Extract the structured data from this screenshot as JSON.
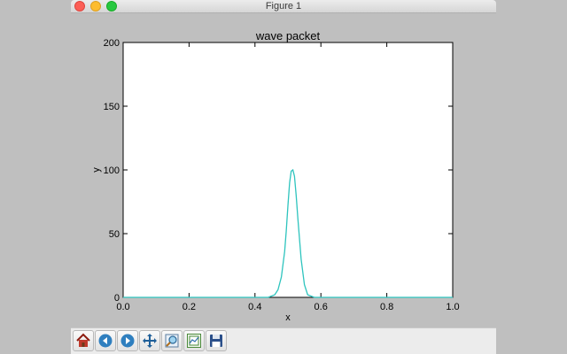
{
  "window": {
    "title": "Figure 1"
  },
  "toolbar": {
    "buttons": [
      {
        "icon": "home-icon",
        "tooltip": "Reset original view"
      },
      {
        "icon": "back-arrow-icon",
        "tooltip": "Back to previous view"
      },
      {
        "icon": "forward-arrow-icon",
        "tooltip": "Forward to next view"
      },
      {
        "icon": "pan-move-icon",
        "tooltip": "Pan axes"
      },
      {
        "icon": "zoom-rectangle-icon",
        "tooltip": "Zoom to rectangle"
      },
      {
        "icon": "configure-subplots-icon",
        "tooltip": "Configure subplots"
      },
      {
        "icon": "save-floppy-icon",
        "tooltip": "Save the figure"
      }
    ]
  },
  "chart_data": {
    "type": "line",
    "title": "wave packet",
    "xlabel": "x",
    "ylabel": "y",
    "xlim": [
      0.0,
      1.0
    ],
    "ylim": [
      0,
      200
    ],
    "xticks": [
      "0.0",
      "0.2",
      "0.4",
      "0.6",
      "0.8",
      "1.0"
    ],
    "yticks": [
      "0",
      "50",
      "100",
      "150",
      "200"
    ],
    "grid": false,
    "series": [
      {
        "color": "#2ec4be",
        "x": [
          0.0,
          0.44,
          0.46,
          0.47,
          0.48,
          0.49,
          0.495,
          0.5,
          0.505,
          0.51,
          0.515,
          0.52,
          0.525,
          0.53,
          0.54,
          0.55,
          0.56,
          0.58,
          1.0
        ],
        "y": [
          0,
          0,
          2,
          6,
          16,
          36,
          52,
          72,
          90,
          99,
          100,
          95,
          80,
          62,
          30,
          10,
          2,
          0,
          0
        ]
      }
    ]
  }
}
